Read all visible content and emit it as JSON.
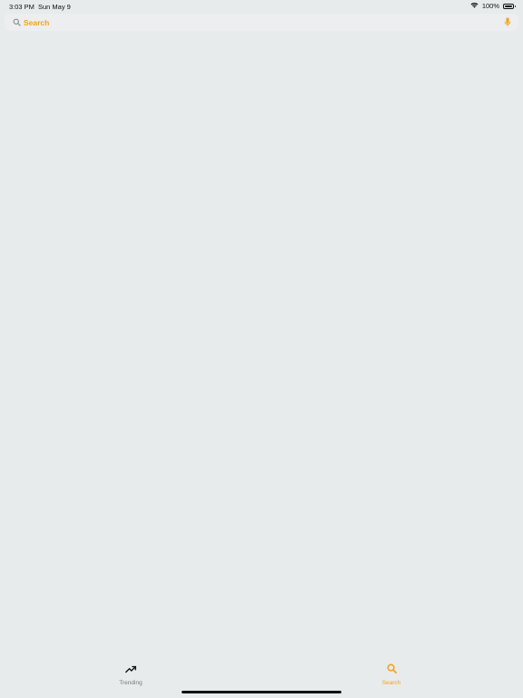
{
  "status_bar": {
    "time": "3:03 PM",
    "date": "Sun May 9",
    "battery": "100%"
  },
  "search": {
    "placeholder": "Search",
    "value": ""
  },
  "tabs": [
    {
      "label": "Trending",
      "icon": "trending-up-icon",
      "active": false
    },
    {
      "label": "Search",
      "icon": "search-icon",
      "active": true
    }
  ],
  "colors": {
    "accent": "#f7a01d",
    "background": "#e8ebec",
    "inactive": "#7a7a7a"
  }
}
